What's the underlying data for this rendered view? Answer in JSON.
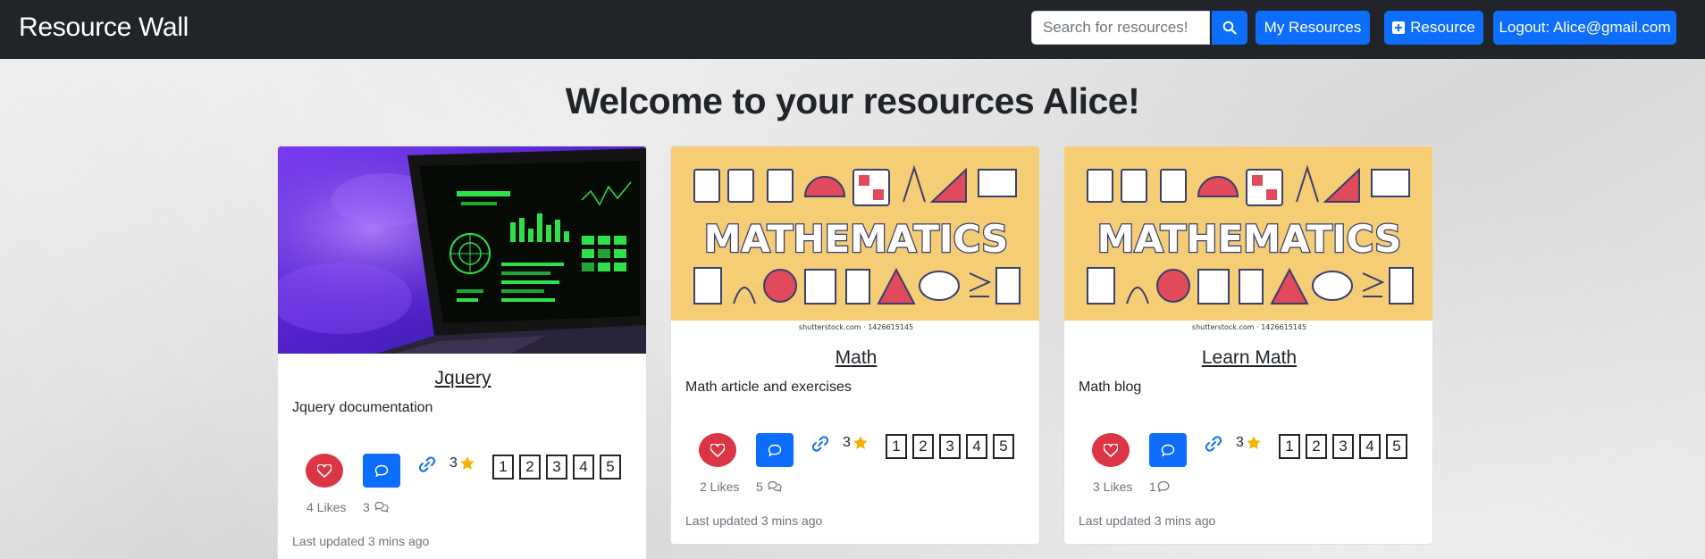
{
  "navbar": {
    "brand": "Resource Wall",
    "search_placeholder": "Search for resources!",
    "search_icon": "search-icon",
    "my_resources_label": "My Resources",
    "add_resource_label": "Resource",
    "add_resource_icon": "plus-square-icon",
    "logout_label": "Logout: Alice@gmail.com"
  },
  "main": {
    "heading": "Welcome to your resources Alice!"
  },
  "cards": [
    {
      "image": "laptop-code-photo",
      "title": "Jquery",
      "description": "Jquery documentation",
      "rating": "3",
      "rating_options": [
        "1",
        "2",
        "3",
        "4",
        "5"
      ],
      "likes_label": "4 Likes",
      "comments_count": "3",
      "updated": "Last updated 3 mins ago"
    },
    {
      "image": "mathematics-banner",
      "image_text": "MATHEMATICS",
      "watermark": "shutterstock.com · 1426615145",
      "title": "Math",
      "description": "Math article and exercises",
      "rating": "3",
      "rating_options": [
        "1",
        "2",
        "3",
        "4",
        "5"
      ],
      "likes_label": "2 Likes",
      "comments_count": "5",
      "updated": "Last updated 3 mins ago"
    },
    {
      "image": "mathematics-banner",
      "image_text": "MATHEMATICS",
      "watermark": "shutterstock.com · 1426615145",
      "title": "Learn Math",
      "description": "Math blog",
      "rating": "3",
      "rating_options": [
        "1",
        "2",
        "3",
        "4",
        "5"
      ],
      "likes_label": "3 Likes",
      "comments_count": "1",
      "updated": "Last updated 3 mins ago"
    }
  ],
  "colors": {
    "navbar": "#212529",
    "primary": "#0d6efd",
    "like": "#dc3545",
    "star": "#f5b301",
    "math_banner": "#f5cd75"
  }
}
